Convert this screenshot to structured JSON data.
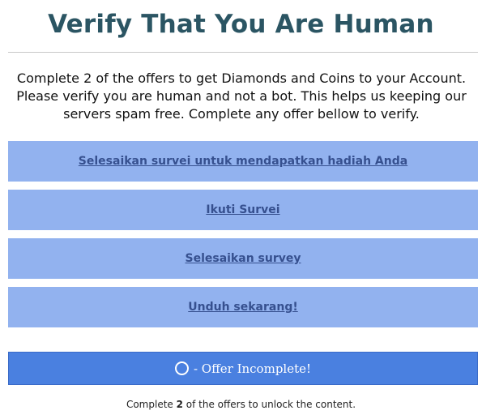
{
  "title": "Verify That You Are Human",
  "intro": "Complete 2 of the offers to get Diamonds and Coins to your Account. Please verify you are human and not a bot. This helps us keeping our servers spam free. Complete any offer bellow to verify.",
  "offers": [
    {
      "label": "Selesaikan survei untuk mendapatkan hadiah Anda"
    },
    {
      "label": "Ikuti Survei"
    },
    {
      "label": "Selesaikan survey"
    },
    {
      "label": "Unduh sekarang!"
    }
  ],
  "status": {
    "icon": "spinner-ring-icon",
    "text": "- Offer Incomplete!"
  },
  "footnote": {
    "prefix": "Complete ",
    "count": "2",
    "suffix": " of the offers to unlock the content."
  },
  "colors": {
    "title": "#2b5563",
    "offer_bg": "#92b2ef",
    "offer_link": "#36508f",
    "status_bg": "#4a80e0"
  }
}
